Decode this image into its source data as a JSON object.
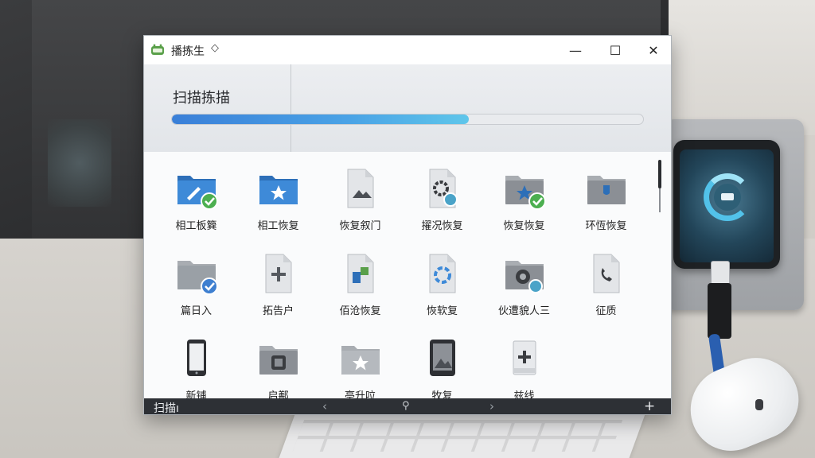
{
  "window": {
    "title": "播拣生",
    "title_caret": "◇",
    "minimize": "—",
    "maximize": "☐",
    "close": "✕"
  },
  "scan": {
    "title": "扫描拣描",
    "progress": 0.63
  },
  "tiles": [
    {
      "label": "相工板簨",
      "icon": "folder-pen-check-icon",
      "color": "#3e8ad8"
    },
    {
      "label": "相工恢复",
      "icon": "folder-star-icon",
      "color": "#3e8ad8"
    },
    {
      "label": "恢复叙门",
      "icon": "image-document-icon",
      "color": "#8b8f95"
    },
    {
      "label": "擢况恢复",
      "icon": "gear-document-icon",
      "color": "#8b8f95"
    },
    {
      "label": "恢复恢复",
      "icon": "folder-star-check-icon",
      "color": "#8b8f95"
    },
    {
      "label": "环恆恢复",
      "icon": "folder-tag-icon",
      "color": "#8b8f95"
    },
    {
      "label": "篇日入",
      "icon": "folder-check-icon",
      "color": "#9aa0a6"
    },
    {
      "label": "拓告户",
      "icon": "add-document-icon",
      "color": "#6f7378"
    },
    {
      "label": "佰沧恢复",
      "icon": "spreadsheet-document-icon",
      "color": "#8b8f95"
    },
    {
      "label": "恢软复",
      "icon": "sync-document-icon",
      "color": "#8b8f95"
    },
    {
      "label": "伙遭貌人三",
      "icon": "folder-gear-icon",
      "color": "#8b8f95"
    },
    {
      "label": "征质",
      "icon": "phone-document-icon",
      "color": "#8b8f95"
    },
    {
      "label": "新铺",
      "icon": "smartphone-icon",
      "color": "#3a3c40"
    },
    {
      "label": "启鄯",
      "icon": "folder-chip-icon",
      "color": "#8b8f95"
    },
    {
      "label": "亭升㕸",
      "icon": "folder-star-gray-icon",
      "color": "#b5b9be"
    },
    {
      "label": "牧复",
      "icon": "tablet-icon",
      "color": "#3a3c40"
    },
    {
      "label": "兹线",
      "icon": "add-box-icon",
      "color": "#6f7378"
    }
  ],
  "bottombar": {
    "label": "扫描ı",
    "prev": "‹",
    "mid": "⚲",
    "next": "›",
    "plus": "+"
  }
}
